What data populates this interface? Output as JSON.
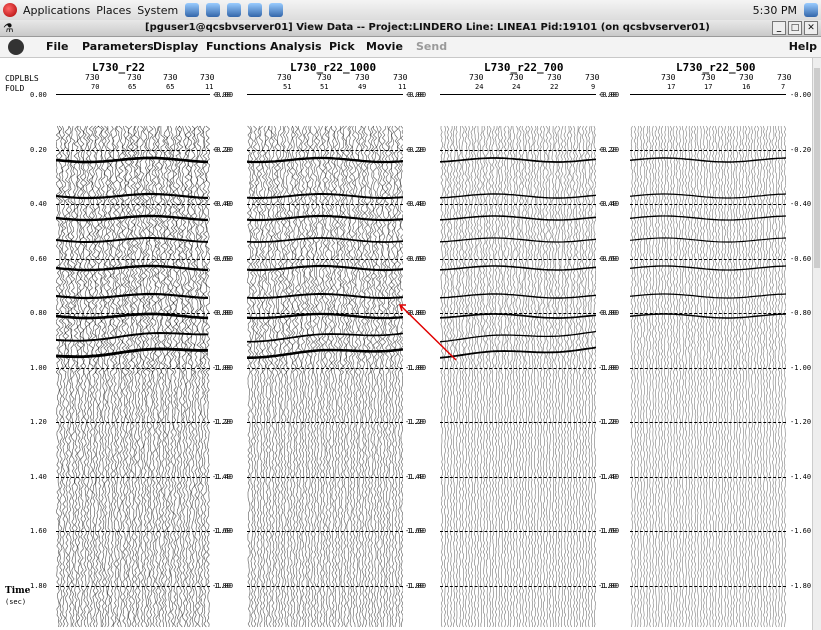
{
  "topbar": {
    "menu": [
      "Applications",
      "Places",
      "System"
    ],
    "clock": "5:30 PM"
  },
  "window": {
    "title": "[pguser1@qcsbvserver01]  View Data  --  Project:LINDERO  Line: LINEA1  Pid:19101 (on qcsbvserver01)"
  },
  "menubar": {
    "items": [
      {
        "label": "File",
        "enabled": true
      },
      {
        "label": "Parameters",
        "enabled": true
      },
      {
        "label": "Display",
        "enabled": true
      },
      {
        "label": "Functions",
        "enabled": true
      },
      {
        "label": "Analysis",
        "enabled": true
      },
      {
        "label": "Pick",
        "enabled": true
      },
      {
        "label": "Movie",
        "enabled": true
      },
      {
        "label": "Send",
        "enabled": false
      }
    ],
    "help": "Help"
  },
  "labels": {
    "cdp": "CDPLBLS",
    "fold": "FOLD",
    "time": "Time",
    "time_unit": "(sec)"
  },
  "panels": [
    {
      "title": "L730_r22",
      "cdps": [
        "730",
        "730",
        "730",
        "730"
      ],
      "fold": [
        "70",
        "65",
        "65",
        "11"
      ]
    },
    {
      "title": "L730_r22_1000",
      "cdps": [
        "730",
        "730",
        "730",
        "730"
      ],
      "fold": [
        "51",
        "51",
        "49",
        "11"
      ]
    },
    {
      "title": "L730_r22_700",
      "cdps": [
        "730",
        "730",
        "730",
        "730"
      ],
      "fold": [
        "24",
        "24",
        "22",
        "9"
      ]
    },
    {
      "title": "L730_r22_500",
      "cdps": [
        "730",
        "730",
        "730",
        "730"
      ],
      "fold": [
        "17",
        "17",
        "16",
        "7"
      ]
    }
  ],
  "time_ticks": [
    "0.00",
    "0.20",
    "0.40",
    "0.60",
    "0.80",
    "1.00",
    "1.20",
    "1.40",
    "1.60",
    "1.80"
  ],
  "colors": {
    "annotation_arrow": "#e00000"
  }
}
